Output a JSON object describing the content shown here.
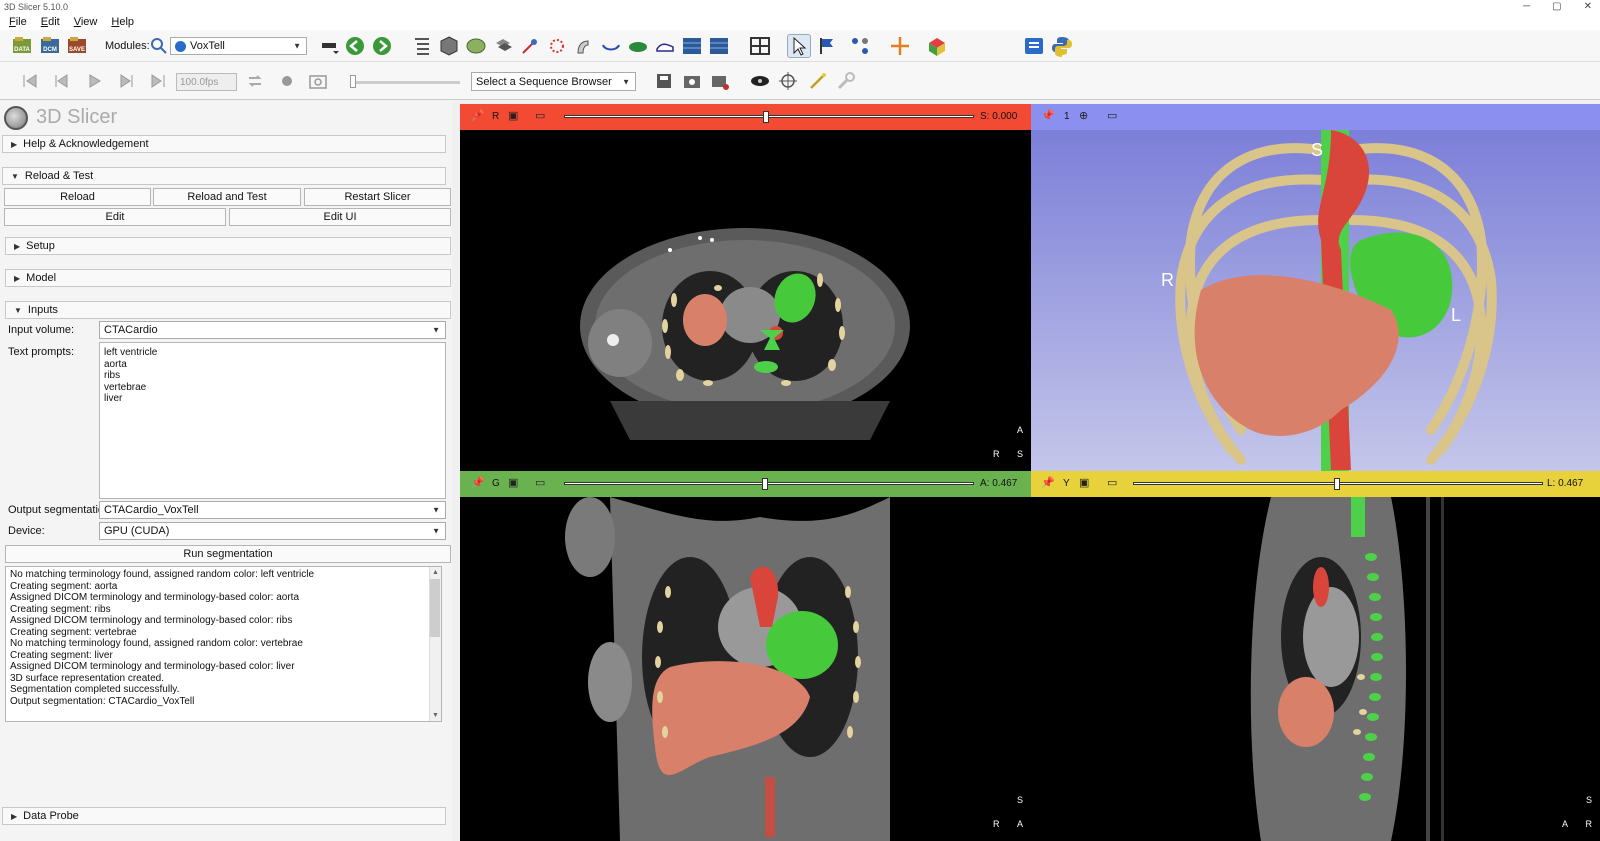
{
  "window": {
    "title": "3D Slicer 5.10.0"
  },
  "menu": [
    "File",
    "Edit",
    "View",
    "Help"
  ],
  "toolbar": {
    "modules_label": "Modules:",
    "module_selected": "VoxTell",
    "data_label": "DATA",
    "dcm_label": "DCM",
    "save_label": "SAVE",
    "fps_value": "100.0fps",
    "sequence_browser": "Select a Sequence Browser"
  },
  "panel": {
    "app_name": "3D Slicer",
    "sections": {
      "help": "Help & Acknowledgement",
      "reload": "Reload & Test",
      "setup": "Setup",
      "model": "Model",
      "inputs": "Inputs",
      "data_probe": "Data Probe"
    },
    "buttons": {
      "reload": "Reload",
      "reload_test": "Reload and Test",
      "restart": "Restart Slicer",
      "edit": "Edit",
      "edit_ui": "Edit UI",
      "run": "Run segmentation"
    },
    "inputs": {
      "input_volume_label": "Input volume:",
      "input_volume": "CTACardio",
      "text_prompts_label": "Text prompts:",
      "prompts": [
        "left ventricle",
        "aorta",
        "ribs",
        "vertebrae",
        "liver"
      ],
      "output_label": "Output segmentation:",
      "output": "CTACardio_VoxTell",
      "device_label": "Device:",
      "device": "GPU (CUDA)"
    },
    "log": [
      "No matching terminology found, assigned random color: left ventricle",
      "Creating segment: aorta",
      "Assigned DICOM terminology and terminology-based color: aorta",
      "Creating segment: ribs",
      "Assigned DICOM terminology and terminology-based color: ribs",
      "Creating segment: vertebrae",
      "No matching terminology found, assigned random color: vertebrae",
      "Creating segment: liver",
      "Assigned DICOM terminology and terminology-based color: liver",
      "3D surface representation created.",
      "Segmentation completed successfully.",
      "Output segmentation: CTACardio_VoxTell"
    ]
  },
  "views": {
    "red": {
      "letter": "R",
      "value": "S: 0.000",
      "color": "#f34a33",
      "slider_fraction": 0.5
    },
    "threed": {
      "letter": "1",
      "color": "#8a8ff0",
      "labels": {
        "top": "S",
        "left": "R",
        "right": "L"
      }
    },
    "green": {
      "letter": "G",
      "value": "A: 0.467",
      "color": "#6ab150",
      "slider_fraction": 0.5
    },
    "yellow": {
      "letter": "Y",
      "value": "L: 0.467",
      "color": "#e8d23c",
      "slider_fraction": 0.5
    },
    "axes": {
      "red": {
        "up": "A",
        "h": "R",
        "v": "S"
      },
      "green": {
        "up": "S",
        "h": "R",
        "v": "A"
      },
      "yellow": {
        "up": "S",
        "h": "A",
        "v": "R"
      }
    }
  },
  "colors": {
    "liver": "#d9806a",
    "left_ventricle": "#47c93c",
    "aorta": "#d9453a",
    "ribs": "#e3d39e",
    "vertebrae": "#4ed04b"
  }
}
